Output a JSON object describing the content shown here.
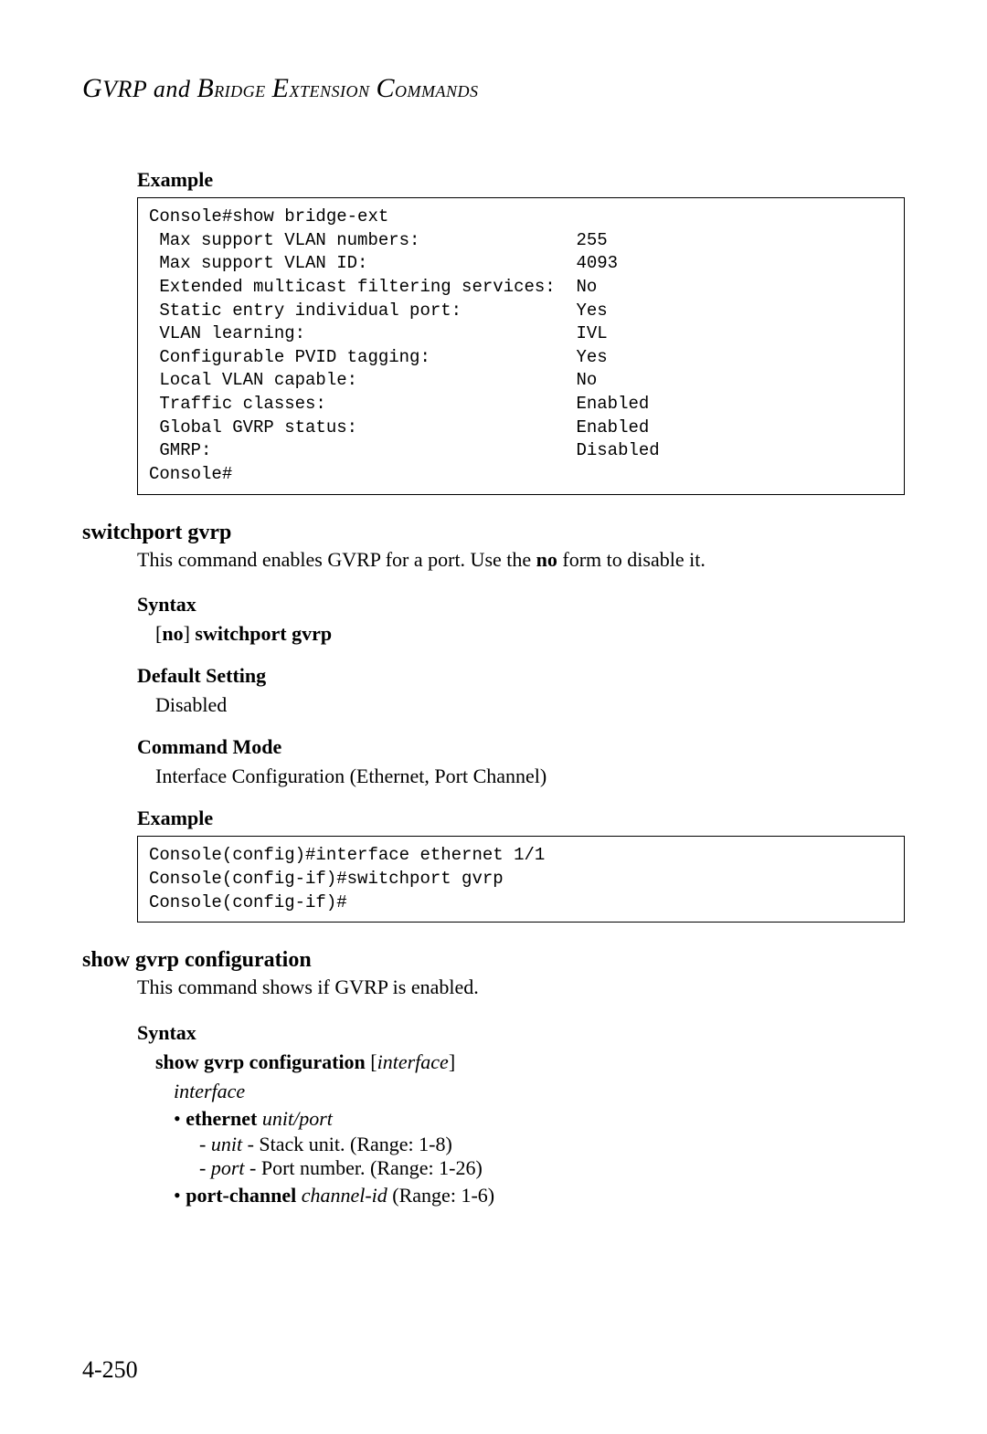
{
  "header": {
    "text": "GVRP and Bridge Extension Commands"
  },
  "sections": [
    {
      "title": "switchport gvrp",
      "description_pre": "This command enables GVRP for a port. Use the ",
      "description_bold": "no",
      "description_post": " form to disable it.",
      "syntax_label": "Syntax",
      "syntax_bracket": "[no] switchport gvrp",
      "default_label": "Default Setting",
      "default_value": "Disabled",
      "mode_label": "Command Mode",
      "mode_value": "Interface Configuration (Ethernet, Port Channel)",
      "example_label": "Example"
    },
    {
      "title": "show gvrp configuration",
      "description": "This command shows if GVRP is enabled.",
      "syntax_label": "Syntax",
      "syntax_cmd": "show gvrp configuration",
      "syntax_param": "interface",
      "interface_lines": {
        "heading": "interface",
        "eth_bold": "ethernet",
        "eth_italic": "unit/port",
        "unit_italic": "unit",
        "unit_text": " - Stack unit. (Range: 1-8)",
        "port_italic": "port",
        "port_text": " - Port number. (Range: 1-26)",
        "pc_bold": "port-channel",
        "pc_italic": "channel-id",
        "pc_text": " (Range: 1-6)"
      }
    }
  ],
  "example1_label": "Example",
  "codebox1": "Console#show bridge-ext\n Max support VLAN numbers:               255\n Max support VLAN ID:                    4093\n Extended multicast filtering services:  No\n Static entry individual port:           Yes\n VLAN learning:                          IVL\n Configurable PVID tagging:              Yes\n Local VLAN capable:                     No\n Traffic classes:                        Enabled\n Global GVRP status:                     Enabled\n GMRP:                                   Disabled\nConsole#",
  "codebox2": "Console(config)#interface ethernet 1/1\nConsole(config-if)#switchport gvrp\nConsole(config-if)#",
  "page_number": "4-250"
}
